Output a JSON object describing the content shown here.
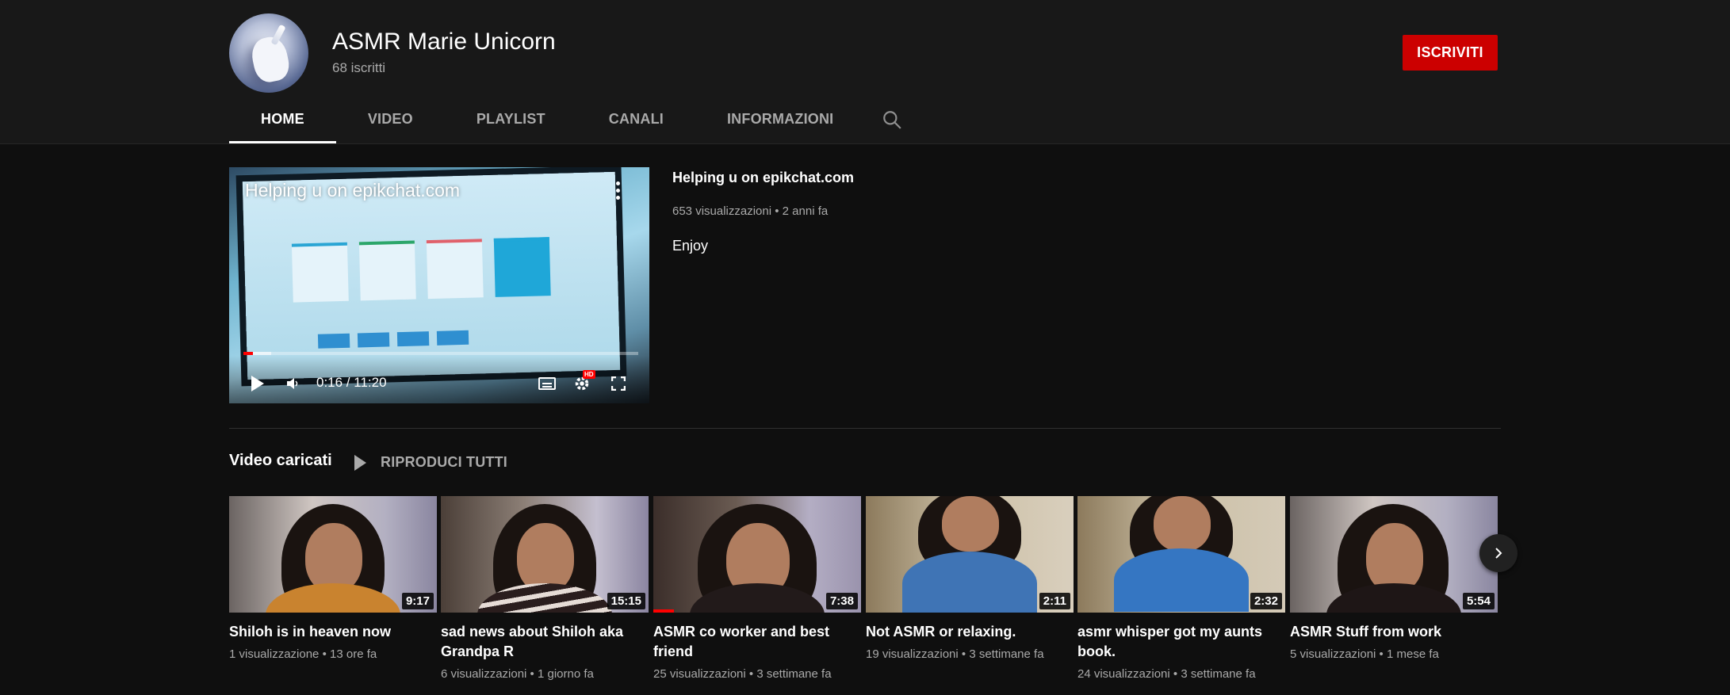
{
  "channel": {
    "name": "ASMR Marie Unicorn",
    "subscribers": "68 iscritti",
    "subscribe_label": "ISCRIVITI",
    "accent": "#cc0000"
  },
  "tabs": [
    {
      "label": "HOME",
      "active": true
    },
    {
      "label": "VIDEO",
      "active": false
    },
    {
      "label": "PLAYLIST",
      "active": false
    },
    {
      "label": "CANALI",
      "active": false
    },
    {
      "label": "INFORMAZIONI",
      "active": false
    }
  ],
  "featured": {
    "player_title": "Helping u on epikchat.com",
    "time": "0:16 / 11:20",
    "progress": 0.024,
    "hd_badge": "HD",
    "title": "Helping u on epikchat.com",
    "views": "653 visualizzazioni",
    "age": "2 anni fa",
    "description": "Enjoy"
  },
  "shelf": {
    "title": "Video caricati",
    "play_all_label": "RIPRODUCI TUTTI",
    "videos": [
      {
        "title": "Shiloh is in heaven now",
        "duration": "9:17",
        "views": "1 visualizzazione",
        "age": "13 ore fa",
        "watched": 0
      },
      {
        "title": "sad news about Shiloh aka Grandpa R",
        "duration": "15:15",
        "views": "6 visualizzazioni",
        "age": "1 giorno fa",
        "watched": 0
      },
      {
        "title": "ASMR co worker and best friend",
        "duration": "7:38",
        "views": "25 visualizzazioni",
        "age": "3 settimane fa",
        "watched": 0.1
      },
      {
        "title": "Not ASMR or relaxing.",
        "duration": "2:11",
        "views": "19 visualizzazioni",
        "age": "3 settimane fa",
        "watched": 0
      },
      {
        "title": "asmr whisper got my aunts book.",
        "duration": "2:32",
        "views": "24 visualizzazioni",
        "age": "3 settimane fa",
        "watched": 0
      },
      {
        "title": "ASMR Stuff from work",
        "duration": "5:54",
        "views": "5 visualizzazioni",
        "age": "1 mese fa",
        "watched": 0
      }
    ]
  },
  "icons": {
    "search": "search-icon",
    "next": "chevron-right-icon",
    "play": "play-icon",
    "volume": "volume-icon",
    "subtitles": "subtitles-icon",
    "settings": "gear-icon",
    "fullscreen": "fullscreen-icon",
    "more": "more-vert-icon"
  }
}
